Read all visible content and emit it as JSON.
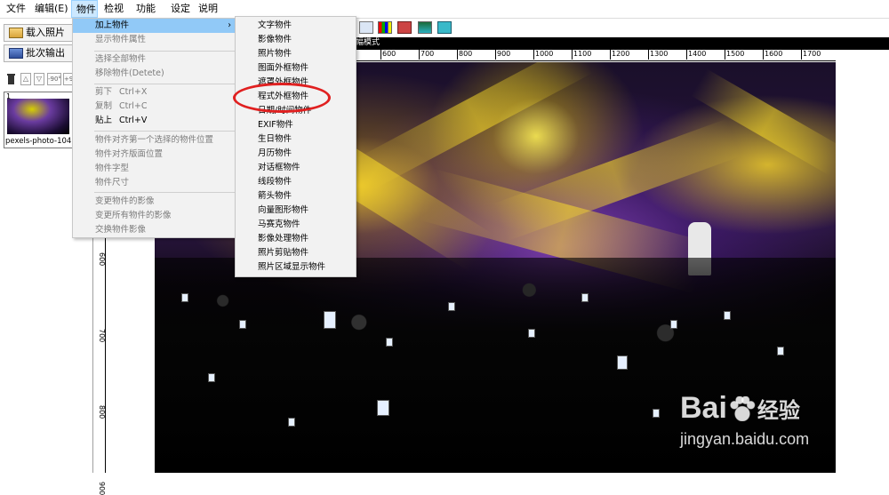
{
  "menubar": {
    "items": [
      {
        "label": "文件"
      },
      {
        "label": "编辑(E)"
      },
      {
        "label": "物件"
      },
      {
        "label": "检视"
      },
      {
        "label": "功能"
      },
      {
        "label": "设定"
      },
      {
        "label": "说明"
      }
    ]
  },
  "toolbar": {
    "load_photo": "载入照片",
    "batch_output": "批次输出"
  },
  "panel_toolbar": {
    "rotate_left": "-90°",
    "rotate_right": "+90°"
  },
  "thumbnail": {
    "index": "1",
    "filename": "pexels-photo-104..."
  },
  "band_text": "幅模式",
  "ruler": {
    "top": [
      "600",
      "700",
      "800",
      "900",
      "1000",
      "1100",
      "1200",
      "1300",
      "1400",
      "1500",
      "1600",
      "1700"
    ],
    "left": [
      "600",
      "700",
      "800",
      "900"
    ]
  },
  "menu_object": {
    "items": [
      {
        "label": "加上物件",
        "arrow": "›"
      },
      {
        "label": "显示物件属性"
      },
      {
        "label": "选择全部物件"
      },
      {
        "label": "移除物件(Detete)"
      },
      {
        "label": "剪下",
        "shortcut": "Ctrl+X"
      },
      {
        "label": "复制",
        "shortcut": "Ctrl+C"
      },
      {
        "label": "贴上",
        "shortcut": "Ctrl+V"
      },
      {
        "label": "物件对齐第一个选择的物件位置"
      },
      {
        "label": "物件对齐版面位置"
      },
      {
        "label": "物件字型"
      },
      {
        "label": "物件尺寸"
      },
      {
        "label": "变更物件的影像"
      },
      {
        "label": "变更所有物件的影像"
      },
      {
        "label": "交换物件影像"
      }
    ]
  },
  "menu_add_object": {
    "items": [
      {
        "label": "文字物件"
      },
      {
        "label": "影像物件"
      },
      {
        "label": "照片物件"
      },
      {
        "label": "图面外框物件"
      },
      {
        "label": "遮罩外框物件"
      },
      {
        "label": "程式外框物件"
      },
      {
        "label": "日期/时间物件"
      },
      {
        "label": "EXIF物件"
      },
      {
        "label": "生日物件"
      },
      {
        "label": "月历物件"
      },
      {
        "label": "对话框物件"
      },
      {
        "label": "线段物件"
      },
      {
        "label": "箭头物件"
      },
      {
        "label": "向量图形物件"
      },
      {
        "label": "马赛克物件"
      },
      {
        "label": "影像处理物件"
      },
      {
        "label": "照片剪贴物件"
      },
      {
        "label": "照片区域显示物件"
      }
    ]
  },
  "watermark": {
    "brand": "Bai",
    "brand_cn": "经验",
    "url": "jingyan.baidu.com"
  },
  "colors": {
    "menu_highlight": "#91c9f7",
    "annotation_circle": "#e02020"
  }
}
